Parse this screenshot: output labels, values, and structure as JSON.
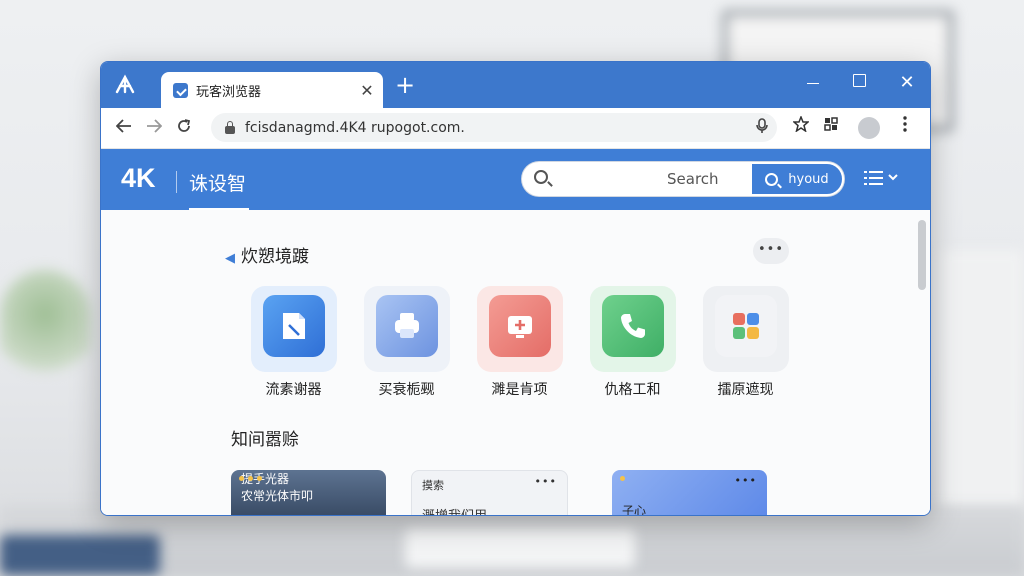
{
  "browser": {
    "tab_title": "玩客浏览器",
    "tab_close": "✕",
    "new_tab": "+",
    "url": "fcisdanagmd.4K4 rupogot.com.",
    "controls": {
      "close": "✕"
    }
  },
  "site": {
    "logo": "4K",
    "name": "诛设智",
    "search_placeholder": "Search",
    "search_button": "hyoud"
  },
  "main": {
    "section_title": "炊愬境踱",
    "more": "•••",
    "apps": [
      {
        "label": "流素谢器",
        "icon": "document-icon"
      },
      {
        "label": "买衰栀觋",
        "icon": "printer-icon"
      },
      {
        "label": "濉是肯项",
        "icon": "medical-icon"
      },
      {
        "label": "仇格工和",
        "icon": "phone-icon"
      },
      {
        "label": "擂原遮现",
        "icon": "puzzle-icon"
      }
    ],
    "section2_title": "知间嚣赊",
    "cards": [
      {
        "line1": "提手光器",
        "line2": "农常光体市叩"
      },
      {
        "line1": "摸索",
        "line2": "溉增我们用"
      },
      {
        "line1": "子心"
      }
    ]
  },
  "colors": {
    "accent": "#3f7ed6",
    "tabbar": "#3d78cc"
  }
}
